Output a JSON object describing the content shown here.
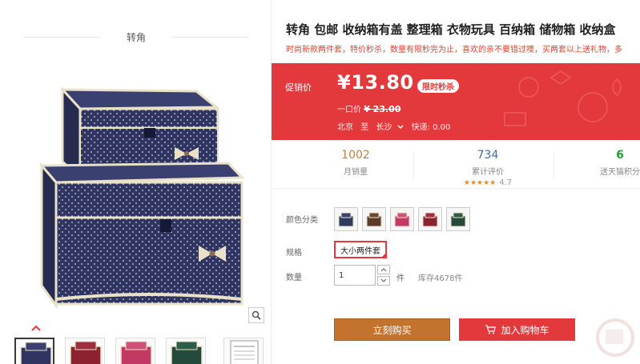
{
  "gallery": {
    "brand": "转角",
    "thumbnails": [
      {
        "name": "navy-box"
      },
      {
        "name": "red-box"
      },
      {
        "name": "pink-box"
      },
      {
        "name": "green-box"
      },
      {
        "name": "info-card"
      }
    ]
  },
  "product": {
    "title": "转角 包邮 收纳箱有盖 整理箱 衣物玩具 百纳箱 储物箱 收纳盒",
    "subtitle": "时尚新款两件套，特价秒杀，数量有限秒完为止，喜欢的亲不要错过噢，买两套以上送礼物，多"
  },
  "price_panel": {
    "promo_label": "促销价",
    "price": "¥13.80",
    "flash_badge": "限时秒杀",
    "orig_label": "一口价",
    "orig_price": "¥ 23.00",
    "ship_from": "北京",
    "ship_to_label": "至",
    "ship_to": "长沙",
    "shipping": "快递: 0.00",
    "color": "#e4393c"
  },
  "stats": {
    "monthly_sales": "1002",
    "monthly_sales_label": "月销量",
    "reviews": "734",
    "reviews_label": "累计评价",
    "rating_stars": "★★★★★",
    "rating_score": "4.7",
    "points": "6",
    "points_label": "送天猫积分"
  },
  "options": {
    "color_label": "颜色分类",
    "colors": [
      {
        "name": "navy",
        "hex": "#2f3a5e"
      },
      {
        "name": "brown",
        "hex": "#5b3b2c"
      },
      {
        "name": "pink",
        "hex": "#c23a63"
      },
      {
        "name": "red",
        "hex": "#8c2230"
      },
      {
        "name": "green",
        "hex": "#234a3a"
      }
    ],
    "spec_label": "规格",
    "spec_value": "大小两件套",
    "qty_label": "数量",
    "qty_value": "1",
    "qty_unit": "件",
    "stock": "库存4678件"
  },
  "actions": {
    "buy_now": "立刻购买",
    "add_to_cart": "加入购物车"
  }
}
